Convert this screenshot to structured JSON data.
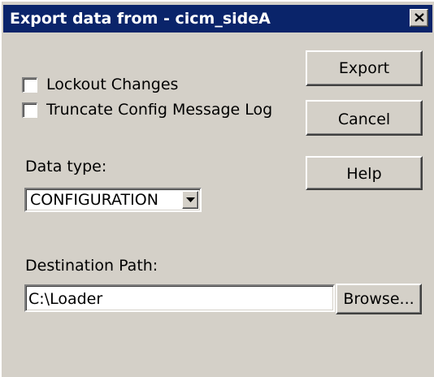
{
  "window": {
    "title": "Export data from - cicm_sideA"
  },
  "options": {
    "lockout_label": "Lockout Changes",
    "lockout_checked": false,
    "truncate_label": "Truncate Config Message Log",
    "truncate_checked": false
  },
  "buttons": {
    "export": "Export",
    "cancel": "Cancel",
    "help": "Help",
    "browse": "Browse..."
  },
  "data_type": {
    "label": "Data type:",
    "selected": "CONFIGURATION"
  },
  "destination": {
    "label": "Destination Path:",
    "value": "C:\\Loader"
  },
  "icons": {
    "close": "close-icon",
    "dropdown": "chevron-down-icon"
  },
  "colors": {
    "titlebar": "#0a246a",
    "face": "#d4d0c8"
  }
}
